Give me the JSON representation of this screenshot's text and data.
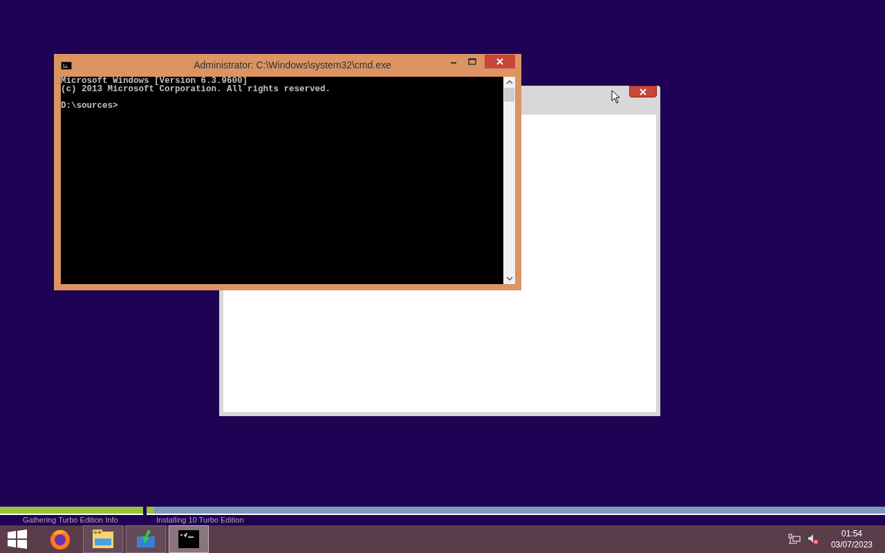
{
  "cmd_window": {
    "title": "Administrator: C:\\Windows\\system32\\cmd.exe",
    "output": [
      "Microsoft Windows [Version 6.3.9600]",
      "(c) 2013 Microsoft Corporation. All rights reserved."
    ],
    "prompt": "D:\\sources>"
  },
  "setup_progress": [
    {
      "label": "Gathering Turbo Edition Info",
      "level": 1
    },
    {
      "label": "Installing 10 Turbo Edition",
      "level": 0.01
    }
  ],
  "taskbar": {
    "items": [
      {
        "kind": "browser",
        "running": false,
        "selected": false
      },
      {
        "kind": "folder",
        "running": true,
        "selected": false
      },
      {
        "kind": "installer",
        "running": true,
        "selected": false
      },
      {
        "kind": "console",
        "running": true,
        "selected": true
      }
    ],
    "clock": {
      "time": "01:54",
      "date": "03/07/2023"
    }
  }
}
